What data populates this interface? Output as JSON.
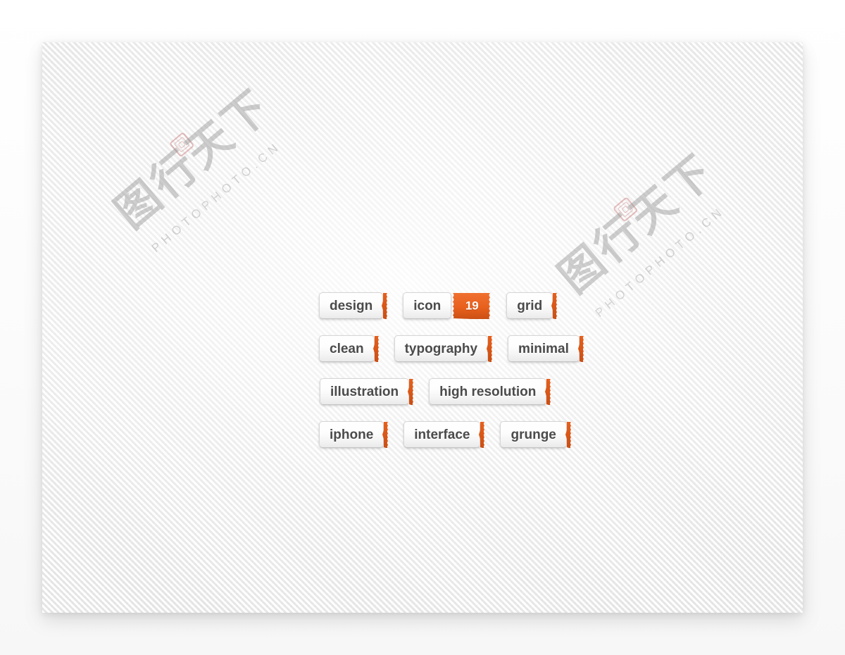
{
  "canvas": {
    "background_color": "#f2f2f2",
    "texture": "woven-crosshatch"
  },
  "theme": {
    "accent_color": "#e8601c",
    "accent_dark": "#c94e13",
    "tag_text_color": "#4b4b4b",
    "tag_background": "#fdfdfd",
    "tag_border_color": "#d6d6d6"
  },
  "watermarks": [
    {
      "cjk": "图行天下",
      "latin": "PHOTOPHOTO.CN",
      "seal": "seal-stamp"
    },
    {
      "cjk": "图行天下",
      "latin": "PHOTOPHOTO.CN",
      "seal": "seal-stamp"
    }
  ],
  "tag_cloud": {
    "rows": [
      {
        "tags": [
          {
            "label": "design",
            "badge": null
          },
          {
            "label": "icon",
            "badge": "19"
          },
          {
            "label": "grid",
            "badge": null
          }
        ]
      },
      {
        "tags": [
          {
            "label": "clean",
            "badge": null
          },
          {
            "label": "typography",
            "badge": null
          },
          {
            "label": "minimal",
            "badge": null
          }
        ]
      },
      {
        "tags": [
          {
            "label": "illustration",
            "badge": null
          },
          {
            "label": "high resolution",
            "badge": null
          }
        ]
      },
      {
        "tags": [
          {
            "label": "iphone",
            "badge": null
          },
          {
            "label": "interface",
            "badge": null
          },
          {
            "label": "grunge",
            "badge": null
          }
        ]
      }
    ]
  }
}
